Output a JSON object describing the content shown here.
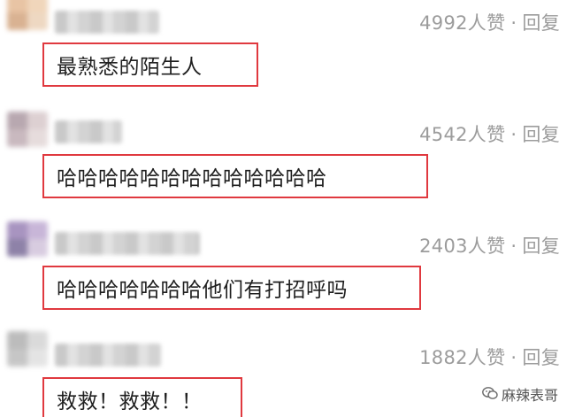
{
  "comments": [
    {
      "likes": "4992",
      "likes_suffix": "人赞",
      "separator": "·",
      "reply_label": "回复",
      "text": "最熟悉的陌生人",
      "avatar_colors": [
        "#e8c4a4",
        "#f0d6bb",
        "#d9b292",
        "#eed8c2"
      ]
    },
    {
      "likes": "4542",
      "likes_suffix": "人赞",
      "separator": "·",
      "reply_label": "回复",
      "text": "哈哈哈哈哈哈哈哈哈哈哈哈哈",
      "avatar_colors": [
        "#b8a8b0",
        "#ddd0d2",
        "#c9b9bf",
        "#e6dcdc"
      ]
    },
    {
      "likes": "2403",
      "likes_suffix": "人赞",
      "separator": "·",
      "reply_label": "回复",
      "text": "哈哈哈哈哈哈哈他们有打招呼吗",
      "avatar_colors": [
        "#a894c0",
        "#c8b6d8",
        "#8e82a8",
        "#d8cce0"
      ]
    },
    {
      "likes": "1882",
      "likes_suffix": "人赞",
      "separator": "·",
      "reply_label": "回复",
      "text": "救救！救救！！",
      "avatar_colors": [
        "#bcbcbc",
        "#dadada",
        "#c6c6c6",
        "#e4e4e4"
      ]
    }
  ],
  "watermark": {
    "icon": "wechat-bubble-icon",
    "text": "麻辣表哥"
  }
}
